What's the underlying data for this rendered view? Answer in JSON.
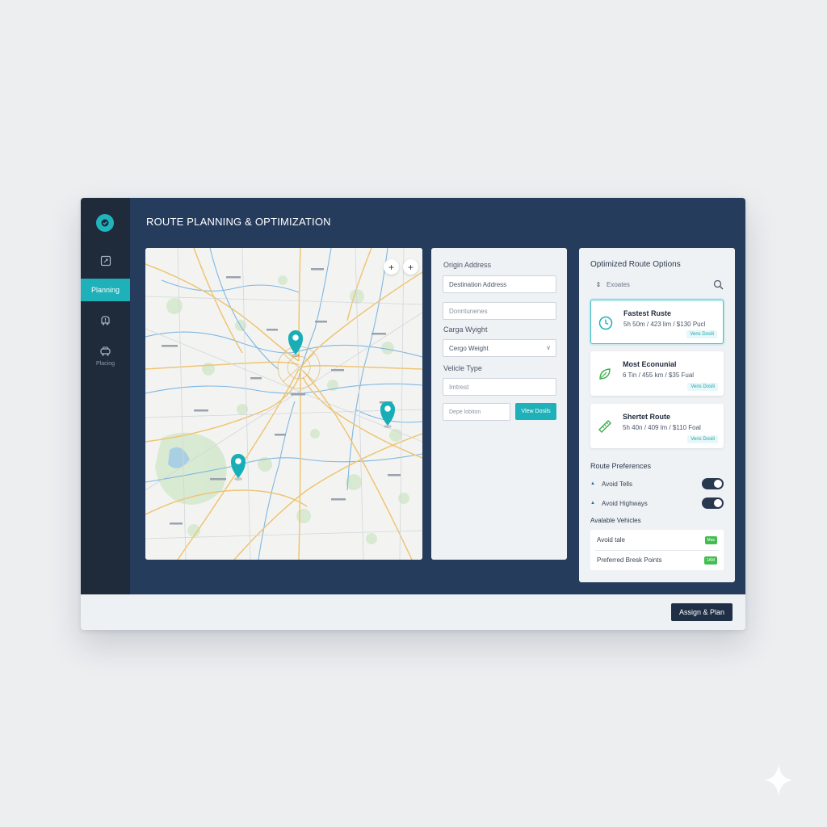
{
  "colors": {
    "accent": "#1fb1b9",
    "sidebar": "#1f2a3a",
    "main": "#253c5c",
    "toggle_on": "#27384f",
    "badge_green": "#3fbf4f"
  },
  "sidebar": {
    "items": [
      {
        "icon": "dashboard-icon"
      },
      {
        "label": "Planning",
        "icon": "planning",
        "active": true
      },
      {
        "icon": "truck-alert-icon"
      },
      {
        "icon": "vehicle-icon",
        "label": "Placing"
      }
    ]
  },
  "header": {
    "title": "ROUTE PLANNING & OPTIMIZATION"
  },
  "map": {
    "zoom_in": "+",
    "zoom_out": "+",
    "pins": 3
  },
  "form": {
    "origin_label": "Origin Address",
    "destination_value": "Destination Address",
    "field2_value": "Donntunenes",
    "cargo_label": "Carga Wyight",
    "cargo_value": "Cergo Weight",
    "vehicle_label": "Velicle Type",
    "vehicle_value": "Imtrest",
    "depot_value": "Depe lobiton",
    "view_button": "Vlew Dosils"
  },
  "routes_panel": {
    "title": "Optimized Route Options",
    "search_text": "Exoates",
    "routes": [
      {
        "name": "Fastest Ruste",
        "stats": "5h 50m / 423 lim / $130 Pucl",
        "button": "Vens Dosili",
        "icon": "clock-icon",
        "selected": true
      },
      {
        "name": "Most Econunial",
        "stats": "6 Tin / 455 km / $35 Fual",
        "button": "Vens Dosili",
        "icon": "leaf-icon",
        "selected": false
      },
      {
        "name": "Shertet Route",
        "stats": "5h 40n / 409 lm / $110 Foal",
        "button": "Vens Dosili",
        "icon": "ruler-icon",
        "selected": false
      }
    ],
    "prefs_title": "Route Preferences",
    "prefs": [
      {
        "label": "Avoid Tells",
        "on": true
      },
      {
        "label": "Avoid Highways",
        "on": true
      }
    ],
    "vehicles_title": "Avalable Vehicles",
    "vehicles": [
      {
        "label": "Avoid tale",
        "badge": "Mas"
      },
      {
        "label": "Preferred Bresk Points",
        "badge": "1AM"
      }
    ]
  },
  "footer": {
    "assign_button": "Assign & Plan"
  }
}
